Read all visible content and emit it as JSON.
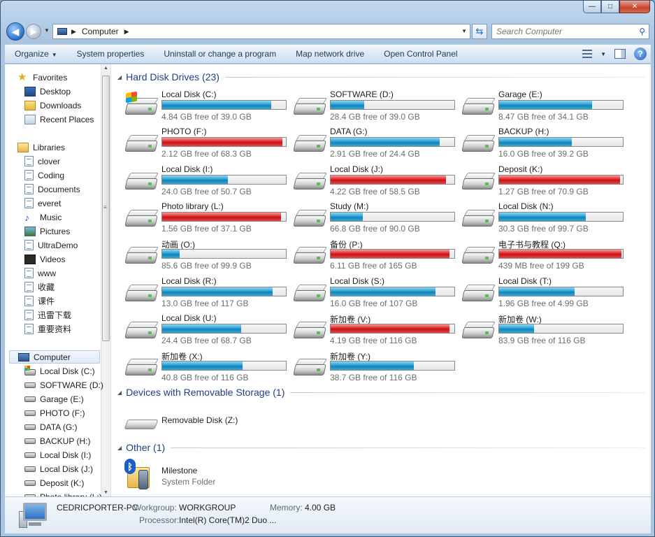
{
  "window": {
    "caption": {
      "minimize": "—",
      "maximize": "□",
      "close": "✕"
    }
  },
  "address": {
    "crumbs": [
      "Computer"
    ],
    "search_placeholder": "Search Computer"
  },
  "toolbar": {
    "organize": "Organize",
    "system_properties": "System properties",
    "uninstall": "Uninstall or change a program",
    "map_drive": "Map network drive",
    "control_panel": "Open Control Panel"
  },
  "nav": {
    "favorites": {
      "label": "Favorites",
      "items": [
        "Desktop",
        "Downloads",
        "Recent Places"
      ]
    },
    "libraries": {
      "label": "Libraries",
      "items": [
        "clover",
        "Coding",
        "Documents",
        "everet",
        "Music",
        "Pictures",
        "UltraDemo",
        "Videos",
        "www",
        "收藏",
        "课件",
        "迅雷下载",
        "重要资料"
      ]
    },
    "computer": {
      "label": "Computer",
      "items": [
        "Local Disk (C:)",
        "SOFTWARE (D:)",
        "Garage (E:)",
        "PHOTO (F:)",
        "DATA (G:)",
        "BACKUP (H:)",
        "Local Disk (I:)",
        "Local Disk (J:)",
        "Deposit (K:)",
        "Photo library (L:)"
      ]
    }
  },
  "groups": {
    "hard_disks": "Hard Disk Drives (23)",
    "removable": "Devices with Removable Storage (1)",
    "other": "Other (1)"
  },
  "drives": [
    {
      "name": "Local Disk (C:)",
      "free": "4.84 GB free of 39.0 GB",
      "used_fraction": 0.88,
      "state": "normal",
      "system": true
    },
    {
      "name": "SOFTWARE (D:)",
      "free": "28.4 GB free of 39.0 GB",
      "used_fraction": 0.27,
      "state": "normal",
      "system": false
    },
    {
      "name": "Garage (E:)",
      "free": "8.47 GB free of 34.1 GB",
      "used_fraction": 0.75,
      "state": "normal",
      "system": false
    },
    {
      "name": "PHOTO (F:)",
      "free": "2.12 GB free of 68.3 GB",
      "used_fraction": 0.97,
      "state": "full",
      "system": false
    },
    {
      "name": "DATA (G:)",
      "free": "2.91 GB free of 24.4 GB",
      "used_fraction": 0.88,
      "state": "normal",
      "system": false
    },
    {
      "name": "BACKUP (H:)",
      "free": "16.0 GB free of 39.2 GB",
      "used_fraction": 0.59,
      "state": "normal",
      "system": false
    },
    {
      "name": "Local Disk (I:)",
      "free": "24.0 GB free of 50.7 GB",
      "used_fraction": 0.53,
      "state": "normal",
      "system": false
    },
    {
      "name": "Local Disk (J:)",
      "free": "4.22 GB free of 58.5 GB",
      "used_fraction": 0.93,
      "state": "full",
      "system": false
    },
    {
      "name": "Deposit (K:)",
      "free": "1.27 GB free of 70.9 GB",
      "used_fraction": 0.98,
      "state": "full",
      "system": false
    },
    {
      "name": "Photo library (L:)",
      "free": "1.56 GB free of 37.1 GB",
      "used_fraction": 0.96,
      "state": "full",
      "system": false
    },
    {
      "name": "Study (M:)",
      "free": "66.8 GB free of 90.0 GB",
      "used_fraction": 0.26,
      "state": "normal",
      "system": false
    },
    {
      "name": "Local Disk (N:)",
      "free": "30.3 GB free of 99.7 GB",
      "used_fraction": 0.7,
      "state": "normal",
      "system": false
    },
    {
      "name": "动画 (O:)",
      "free": "85.6 GB free of 99.9 GB",
      "used_fraction": 0.14,
      "state": "normal",
      "system": false
    },
    {
      "name": "备份 (P:)",
      "free": "6.11 GB free of 165 GB",
      "used_fraction": 0.96,
      "state": "full",
      "system": false
    },
    {
      "name": "电子书与教程 (Q:)",
      "free": "439 MB free of 199 GB",
      "used_fraction": 0.99,
      "state": "full",
      "system": false
    },
    {
      "name": "Local Disk (R:)",
      "free": "13.0 GB free of 117 GB",
      "used_fraction": 0.89,
      "state": "normal",
      "system": false
    },
    {
      "name": "Local Disk (S:)",
      "free": "16.0 GB free of 107 GB",
      "used_fraction": 0.85,
      "state": "normal",
      "system": false
    },
    {
      "name": "Local Disk (T:)",
      "free": "1.96 GB free of 4.99 GB",
      "used_fraction": 0.61,
      "state": "normal",
      "system": false
    },
    {
      "name": "Local Disk (U:)",
      "free": "24.4 GB free of 68.7 GB",
      "used_fraction": 0.64,
      "state": "normal",
      "system": false
    },
    {
      "name": "新加卷 (V:)",
      "free": "4.19 GB free of 116 GB",
      "used_fraction": 0.96,
      "state": "full",
      "system": false
    },
    {
      "name": "新加卷 (W:)",
      "free": "83.9 GB free of 116 GB",
      "used_fraction": 0.28,
      "state": "normal",
      "system": false
    },
    {
      "name": "新加卷 (X:)",
      "free": "40.8 GB free of 116 GB",
      "used_fraction": 0.65,
      "state": "normal",
      "system": false
    },
    {
      "name": "新加卷 (Y:)",
      "free": "38.7 GB free of 116 GB",
      "used_fraction": 0.67,
      "state": "normal",
      "system": false
    }
  ],
  "removable": {
    "name": "Removable Disk (Z:)"
  },
  "other": {
    "name": "Milestone",
    "type": "System Folder"
  },
  "details": {
    "computer_name": "CEDRICPORTER-PC",
    "workgroup_label": "Workgroup:",
    "workgroup": "WORKGROUP",
    "memory_label": "Memory:",
    "memory": "4.00 GB",
    "processor_label": "Processor:",
    "processor": "Intel(R) Core(TM)2 Duo ..."
  },
  "colors": {
    "bar_normal": "#27a3d6",
    "bar_full": "#e3262a",
    "group_title": "#1e3f87"
  },
  "icons": {
    "back": "back-arrow-icon",
    "forward": "forward-arrow-icon",
    "refresh": "refresh-icon",
    "search": "search-icon",
    "views": "views-icon",
    "preview_pane": "preview-pane-icon",
    "help": "help-icon"
  }
}
